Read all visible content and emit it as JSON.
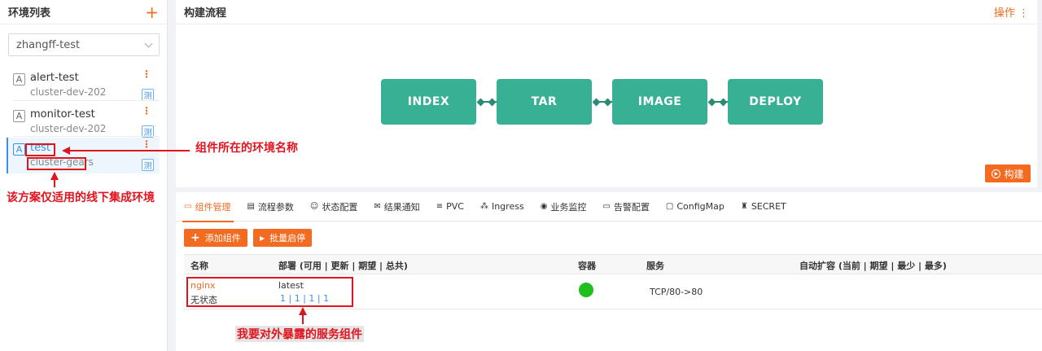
{
  "sidebar": {
    "title": "环境列表",
    "add_symbol": "+",
    "selected_namespace": "zhangff-test",
    "envs": [
      {
        "badge": "A",
        "name": "alert-test",
        "cluster": "cluster-dev-202",
        "more": "⋮",
        "tag": "测"
      },
      {
        "badge": "A",
        "name": "monitor-test",
        "cluster": "cluster-dev-202",
        "more": "⋮",
        "tag": "测"
      },
      {
        "badge": "A",
        "name": "test",
        "cluster": "cluster-gears",
        "more": "⋮",
        "tag": "测"
      }
    ]
  },
  "pipeline": {
    "title": "构建流程",
    "ops_label": "操作 ⋮",
    "stages": [
      "INDEX",
      "TAR",
      "IMAGE",
      "DEPLOY"
    ],
    "build_label": "构建"
  },
  "tabs": [
    {
      "icon": "▭",
      "label": "组件管理"
    },
    {
      "icon": "▤",
      "label": "流程参数"
    },
    {
      "icon": "☺",
      "label": "状态配置"
    },
    {
      "icon": "✉",
      "label": "结果通知"
    },
    {
      "icon": "≡",
      "label": "PVC"
    },
    {
      "icon": "⁂",
      "label": "Ingress"
    },
    {
      "icon": "◉",
      "label": "业务监控"
    },
    {
      "icon": "▭",
      "label": "告警配置"
    },
    {
      "icon": "▢",
      "label": "ConfigMap"
    },
    {
      "icon": "♜",
      "label": "SECRET"
    }
  ],
  "actions": {
    "add_component": "添加组件",
    "batch_toggle": "批量启停"
  },
  "table": {
    "headers": [
      "名称",
      "部署 (可用 | 更新 | 期望 | 总共)",
      "容器",
      "服务",
      "自动扩容 (当前 | 期望 | 最少 | 最多)"
    ],
    "row": {
      "name": "nginx",
      "status": "无状态",
      "tag": "latest",
      "deploy": "1 | 1 | 1 | 1",
      "service": "TCP/80->80"
    }
  },
  "annotations": {
    "env_name": "组件所在的环境名称",
    "offline_only": "该方案仅适用的线下集成环境",
    "expose": "我要对外暴露的服务组件"
  },
  "colors": {
    "accent": "#f26b21",
    "stage": "#38b094",
    "annotation": "#e0141e",
    "link": "#3b8ee8"
  }
}
